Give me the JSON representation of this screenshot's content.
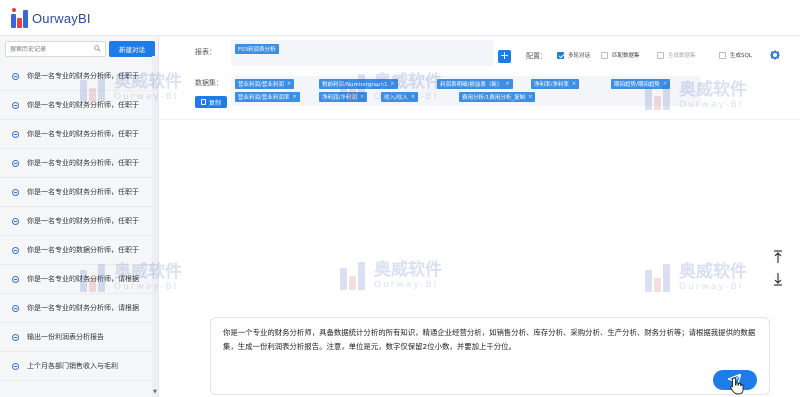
{
  "app": {
    "title": "OurwayBI"
  },
  "sidebar": {
    "search_placeholder": "搜索历史记录",
    "new_chat_label": "新建对话",
    "history": [
      "你是一名专业的财务分析师，任职于",
      "你是一名专业的财务分析师，任职于",
      "你是一名专业的财务分析师，任职于",
      "你是一名专业的财务分析师，任职于",
      "你是一名专业的财务分析师，任职于",
      "你是一名专业的财务分析师，任职于",
      "你是一名专业的数据分析师，任职于",
      "你是一名专业的财务分析师，请根据",
      "你是一名专业的财务分析师，请根据",
      "输出一份利润表分析报告",
      "上个月各部门销售收入与毛利"
    ]
  },
  "config": {
    "report_label": "报表：",
    "report_tag": "F03利润表分析",
    "config_label": "配置：",
    "options": [
      {
        "label": "多轮对话",
        "checked": true,
        "disabled": false
      },
      {
        "label": "匹配数据集",
        "checked": false,
        "disabled": false
      },
      {
        "label": "生成数据集",
        "checked": false,
        "disabled": true
      },
      {
        "label": "生成SQL",
        "checked": false,
        "disabled": false
      }
    ],
    "dataset_label": "数据集：",
    "copy_label": "复制",
    "datasets_row1": [
      "营业利润/营业利润",
      "税前利润/Numbergraph1",
      "利润表明细/损益表（新）",
      "净利率/净利率",
      "期间趋势/期间趋势"
    ],
    "datasets_row2": [
      "营业利润/营业利润率",
      "净利润/净利润",
      "收入/收入",
      "费用分析/1费用分析_复制"
    ]
  },
  "input": {
    "text": "你是一个专业的财务分析师，具备数据统计分析的所有知识，精通企业经营分析，如销售分析、库存分析、采购分析、生产分析、财务分析等；请根据我提供的数据集，生成一份利润表分析报告。注意，单位是元，数字仅保留2位小数，并要加上千分位。"
  },
  "watermark": {
    "cn": "奥威软件",
    "en": "Ourway-BI"
  },
  "colors": {
    "primary": "#1e7ce8",
    "tag": "#3d8fe6",
    "logo_blue": "#3a67d8",
    "logo_red": "#e0433f"
  }
}
